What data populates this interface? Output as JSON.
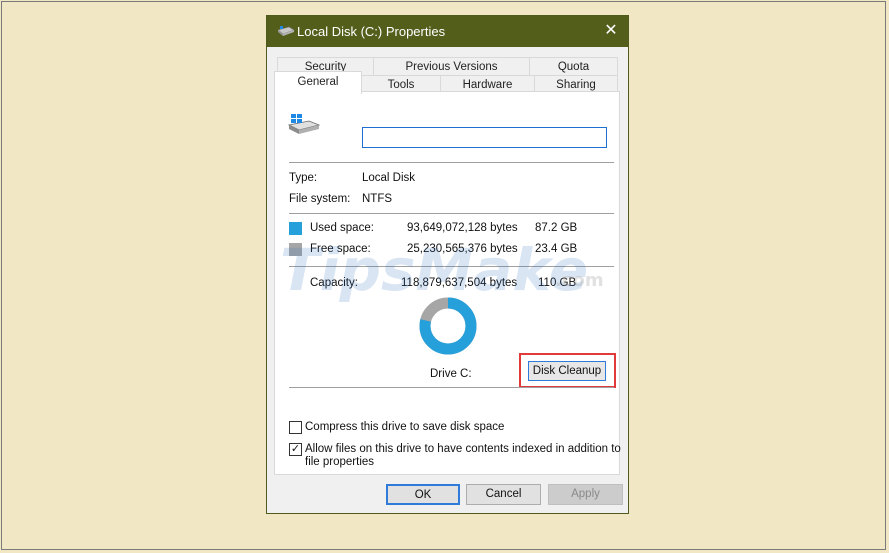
{
  "window": {
    "title": "Local Disk (C:) Properties"
  },
  "tabs_row1": [
    {
      "label": "Security"
    },
    {
      "label": "Previous Versions"
    },
    {
      "label": "Quota"
    }
  ],
  "tabs_row2": [
    {
      "label": "General",
      "active": true
    },
    {
      "label": "Tools"
    },
    {
      "label": "Hardware"
    },
    {
      "label": "Sharing"
    }
  ],
  "general": {
    "name_value": "",
    "type_label": "Type:",
    "type_value": "Local Disk",
    "fs_label": "File system:",
    "fs_value": "NTFS",
    "used": {
      "label": "Used space:",
      "bytes": "93,649,072,128 bytes",
      "size": "87.2 GB",
      "color": "#26a0da"
    },
    "free": {
      "label": "Free space:",
      "bytes": "25,230,565,376 bytes",
      "size": "23.4 GB",
      "color": "#a6a6a6"
    },
    "capacity": {
      "label": "Capacity:",
      "bytes": "118,879,637,504 bytes",
      "size": "110 GB"
    },
    "used_fraction": 0.788,
    "drive_label": "Drive C:",
    "cleanup_label": "Disk Cleanup",
    "compress_label": "Compress this drive to save disk space",
    "compress_checked": false,
    "index_label_line1": "Allow files on this drive to have contents indexed in addition to",
    "index_label_line2": "file properties",
    "index_checked": true
  },
  "footer": {
    "ok": "OK",
    "cancel": "Cancel",
    "apply": "Apply"
  },
  "watermark": {
    "text": "TipsMake",
    "suffix": ".com"
  }
}
